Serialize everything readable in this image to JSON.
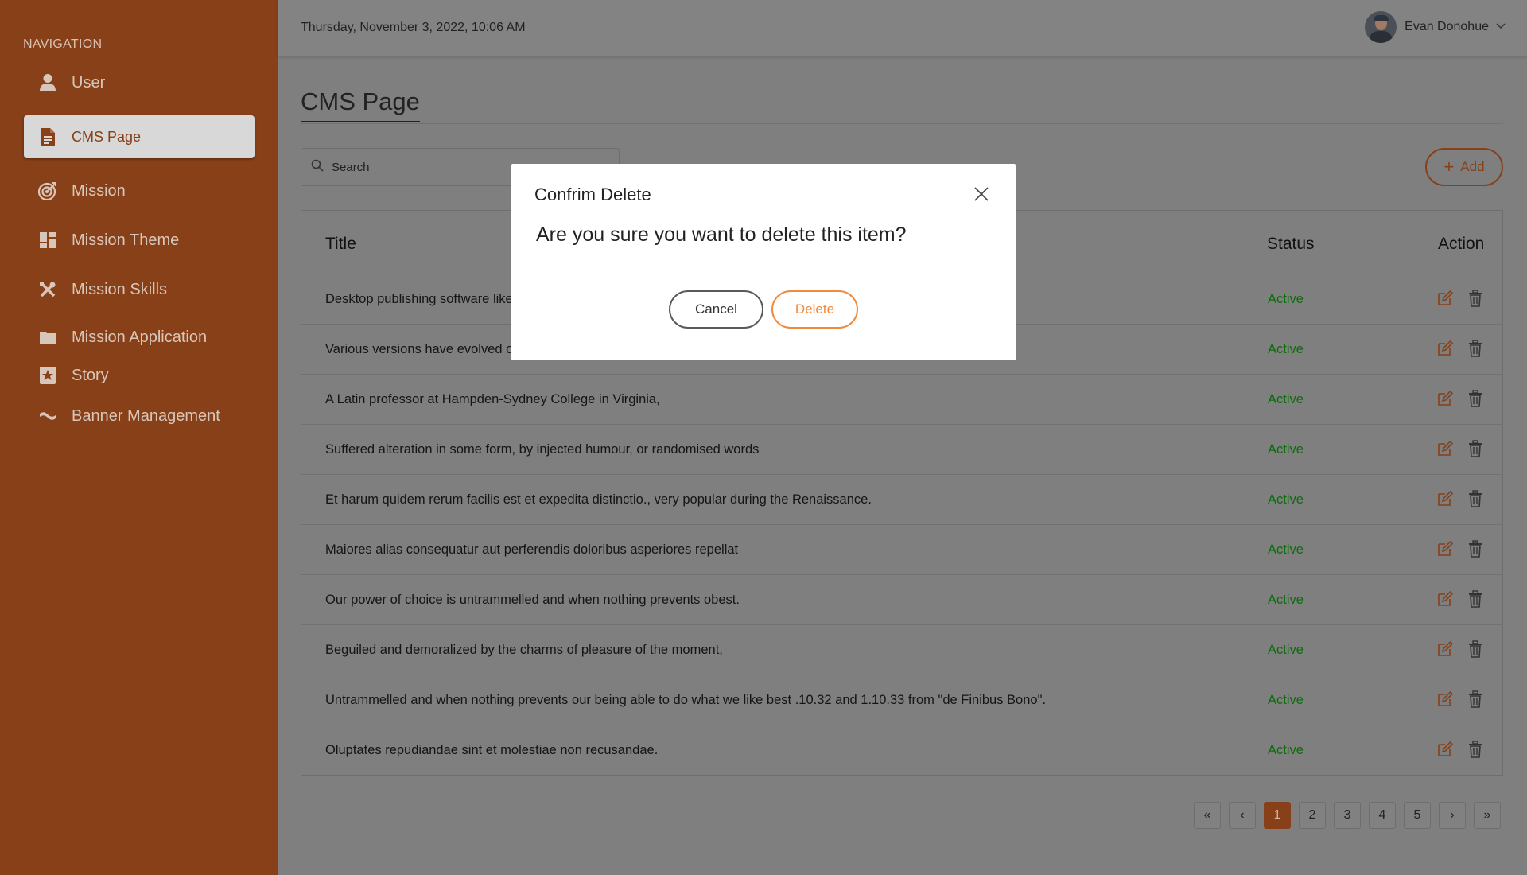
{
  "sidebar": {
    "heading": "NAVIGATION",
    "items": [
      {
        "label": "User",
        "icon": "user-icon"
      },
      {
        "label": "CMS Page",
        "icon": "document-icon",
        "active": true
      },
      {
        "label": "Mission",
        "icon": "target-icon"
      },
      {
        "label": "Mission Theme",
        "icon": "dashboard-icon"
      },
      {
        "label": "Mission Skills",
        "icon": "tools-icon"
      },
      {
        "label": "Mission Application",
        "icon": "folder-icon"
      },
      {
        "label": "Story",
        "icon": "bookmark-icon"
      },
      {
        "label": "Banner Management",
        "icon": "banner-icon"
      }
    ]
  },
  "header": {
    "date": "Thursday, November 3, 2022, 10:06 AM",
    "user_name": "Evan Donohue"
  },
  "page": {
    "title": "CMS Page",
    "search_placeholder": "Search",
    "add_label": "Add"
  },
  "table": {
    "columns": {
      "title": "Title",
      "status": "Status",
      "action": "Action"
    },
    "rows": [
      {
        "title": "Desktop publishing software like",
        "status": "Active"
      },
      {
        "title": "Various versions have evolved o",
        "status": "Active"
      },
      {
        "title": "A Latin professor at Hampden-Sydney College in Virginia,",
        "status": "Active"
      },
      {
        "title": "Suffered alteration in some form, by injected humour, or randomised words",
        "status": "Active"
      },
      {
        "title": "Et harum quidem rerum facilis est et expedita distinctio., very popular during the Renaissance.",
        "status": "Active"
      },
      {
        "title": "Maiores alias consequatur aut perferendis doloribus asperiores repellat",
        "status": "Active"
      },
      {
        "title": "Our power of choice is untrammelled and when nothing prevents obest.",
        "status": "Active"
      },
      {
        "title": "Beguiled and demoralized by the charms of pleasure of the moment,",
        "status": "Active"
      },
      {
        "title": "Untrammelled and when nothing prevents our being able to do what we like best .10.32 and 1.10.33 from \"de Finibus Bono\".",
        "status": "Active"
      },
      {
        "title": "Oluptates repudiandae sint et molestiae non recusandae.",
        "status": "Active"
      }
    ]
  },
  "pagination": {
    "first": "«",
    "prev": "‹",
    "pages": [
      "1",
      "2",
      "3",
      "4",
      "5"
    ],
    "current": "1",
    "next": "›",
    "last": "»"
  },
  "modal": {
    "title": "Confrim Delete",
    "message": "Are you sure you want to delete this item?",
    "cancel_label": "Cancel",
    "delete_label": "Delete"
  },
  "colors": {
    "brand": "#874018",
    "accent": "#f08a3c",
    "status_active": "#0a6d0a",
    "overlay": "#7f7f7f"
  }
}
